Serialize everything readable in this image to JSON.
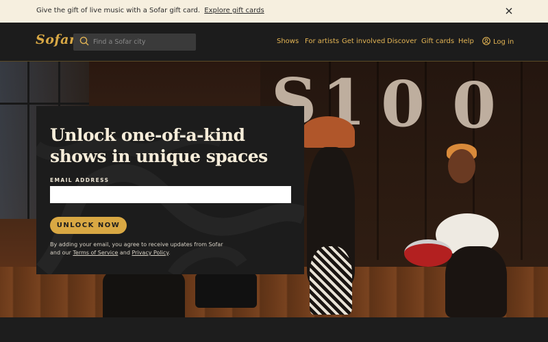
{
  "banner": {
    "message": "Give the gift of live music with a Sofar gift card.",
    "link_label": "Explore gift cards"
  },
  "header": {
    "logo": "Sofar",
    "search_placeholder": "Find a Sofar city",
    "nav": {
      "shows": "Shows",
      "for_artists": "For artists",
      "get_involved": "Get involved",
      "discover": "Discover",
      "gift_cards": "Gift cards",
      "help": "Help",
      "login": "Log in"
    }
  },
  "hero": {
    "backdrop_letters": [
      "S",
      "1",
      "0",
      "0"
    ],
    "card": {
      "headline": "Unlock one-of-a-kind shows in unique spaces",
      "email_label": "EMAIL ADDRESS",
      "email_value": "",
      "cta": "UNLOCK NOW",
      "legal_prefix": "By adding your email, you agree to receive updates from Sofar and our",
      "terms_label": "Terms of Service",
      "legal_and": "and",
      "privacy_label": "Privacy Policy",
      "legal_suffix": "."
    }
  },
  "colors": {
    "accent": "#d9a843",
    "banner_bg": "#f6efdf",
    "header_bg": "#1c1c1c",
    "nav_text": "#e3b454",
    "card_bg": "#1c1c1c",
    "headline": "#f5ecd9"
  },
  "icons": {
    "search": "search-icon",
    "close": "close-icon",
    "user": "user-icon"
  }
}
